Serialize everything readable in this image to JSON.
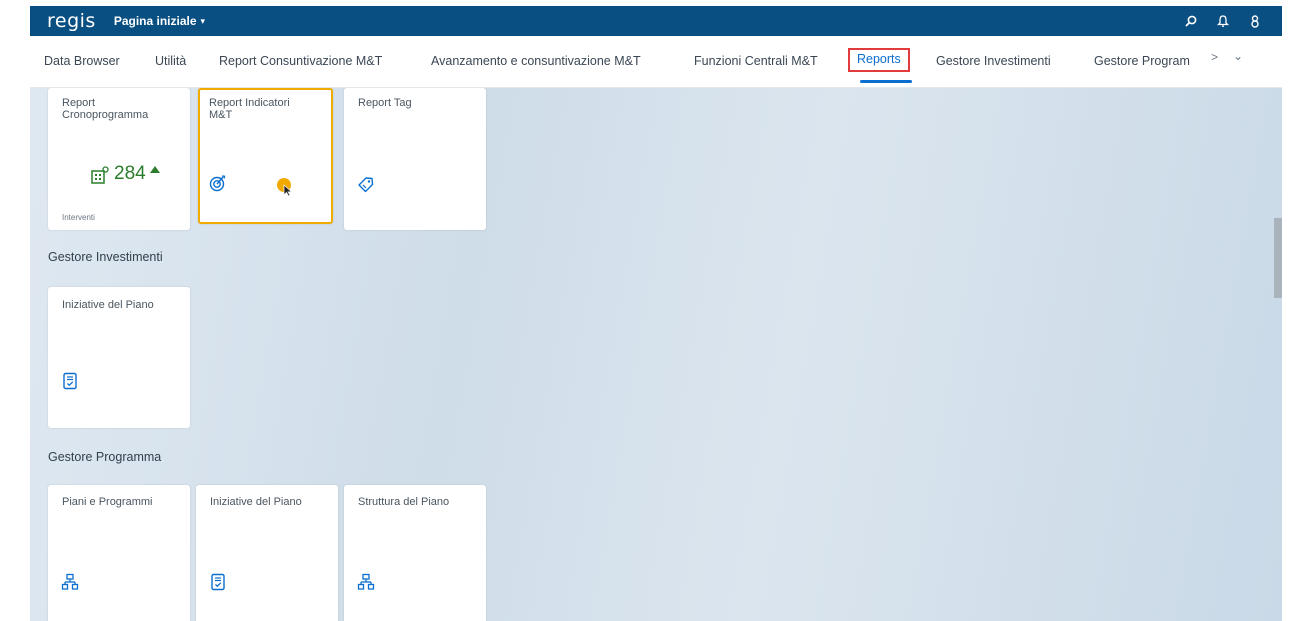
{
  "shell": {
    "logo": "regis",
    "home_title": "Pagina iniziale",
    "icons": [
      "search-icon",
      "bell-icon",
      "user-icon"
    ]
  },
  "tabs": [
    {
      "label": "Data Browser",
      "active": false
    },
    {
      "label": "Utilità",
      "active": false
    },
    {
      "label": "Report Consuntivazione M&T",
      "active": false
    },
    {
      "label": "Avanzamento e consuntivazione M&T",
      "active": false
    },
    {
      "label": "Funzioni Centrali M&T",
      "active": false
    },
    {
      "label": "Reports",
      "active": true
    },
    {
      "label": "Gestore Investimenti",
      "active": false
    },
    {
      "label": "Gestore Program",
      "active": false
    }
  ],
  "tabs_overflow": ">",
  "tabs_more": "⌄",
  "sections": {
    "reports": {
      "tiles": [
        {
          "title": "Report Cronoprogramma",
          "kpi_value": "284",
          "kpi_trend": "up",
          "footer": "Interventi",
          "icon": "building-chart-icon"
        },
        {
          "title": "Report Indicatori M&T",
          "icon": "target-icon",
          "focused": true
        },
        {
          "title": "Report Tag",
          "icon": "tag-icon"
        }
      ]
    },
    "gestore_investimenti": {
      "title": "Gestore Investimenti",
      "tiles": [
        {
          "title": "Iniziative del Piano",
          "icon": "document-check-icon"
        }
      ]
    },
    "gestore_programma": {
      "title": "Gestore Programma",
      "tiles": [
        {
          "title": "Piani e Programmi",
          "icon": "hierarchy-icon"
        },
        {
          "title": "Iniziative del Piano",
          "icon": "document-check-icon"
        },
        {
          "title": "Struttura del Piano",
          "icon": "hierarchy-icon"
        }
      ]
    }
  },
  "colors": {
    "shell": "#0a4f82",
    "accent": "#0a6ed1",
    "active_tab_border": "#e23b3b",
    "focus": "#f0ab00",
    "kpi_positive": "#2b7d2b"
  }
}
